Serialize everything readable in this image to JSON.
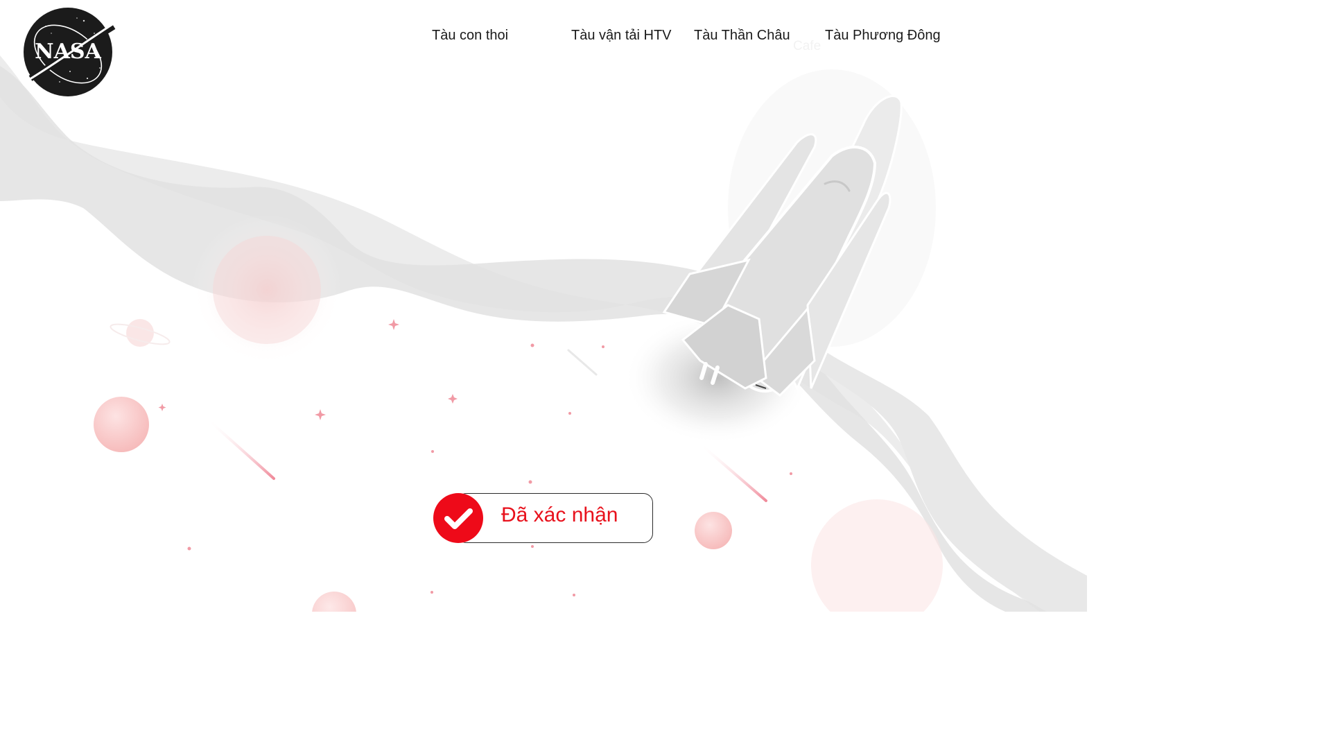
{
  "brand": {
    "logo_text": "NASA",
    "logo_icon": "nasa-meatball-logo"
  },
  "nav": {
    "items": [
      {
        "label": "Tàu con thoi"
      },
      {
        "label": "Tàu vận tải HTV"
      },
      {
        "label": "Tàu Thần Châu"
      },
      {
        "label": "Tàu Phương Đông"
      }
    ],
    "faint_item": "Cafe"
  },
  "status": {
    "label": "Đã xác nhận",
    "icon": "check-icon"
  },
  "illustration": {
    "subject": "space-shuttle-icon"
  },
  "colors": {
    "accent_red": "#ee0a19",
    "status_text": "#e8111c",
    "wave_gray": "#e6e6e6",
    "planet_pink": "#f7c2c2"
  }
}
